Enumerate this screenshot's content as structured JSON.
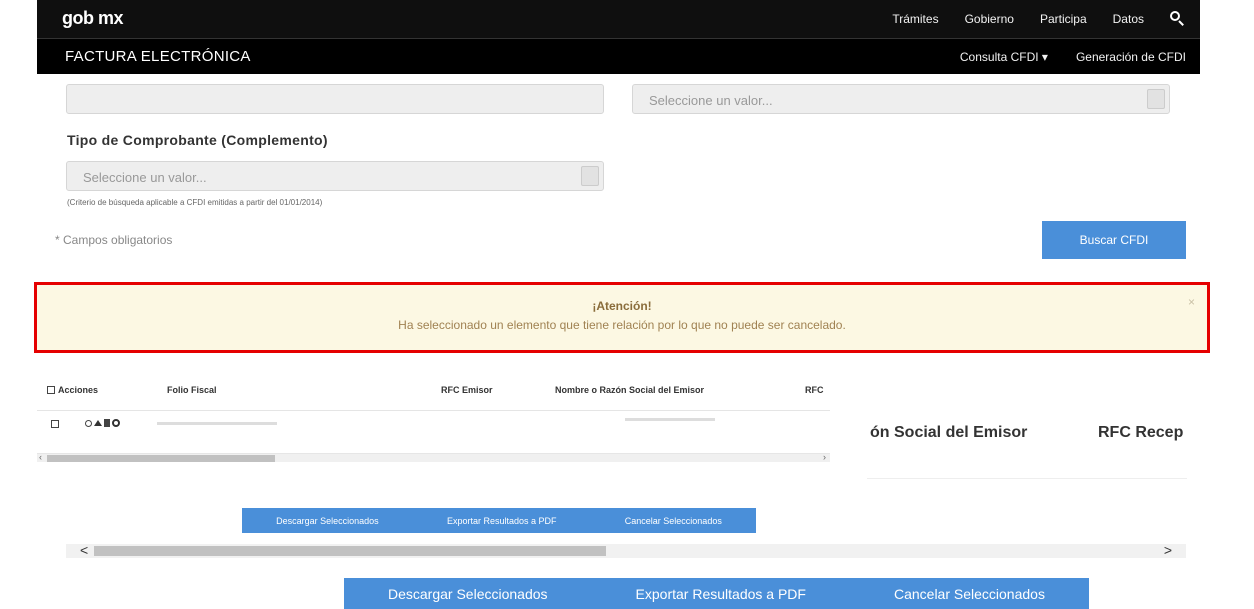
{
  "header": {
    "logo": "gob mx",
    "nav": [
      "Trámites",
      "Gobierno",
      "Participa",
      "Datos"
    ],
    "search_icon": "search-icon"
  },
  "subheader": {
    "title": "FACTURA ELECTRÓNICA",
    "nav": [
      "Consulta CFDI ▾",
      "Generación de CFDI"
    ]
  },
  "form": {
    "select_placeholder": "Seleccione un valor...",
    "tipo_label": "Tipo de Comprobante (Complemento)",
    "tipo_placeholder": "Seleccione un valor...",
    "hint": "(Criterio de búsqueda aplicable a CFDI emitidas a partir del 01/01/2014)",
    "required_note": "* Campos obligatorios",
    "search_button": "Buscar CFDI"
  },
  "alert": {
    "title": "¡Atención!",
    "message": "Ha seleccionado un elemento que tiene relación por lo que no puede ser cancelado.",
    "close": "×",
    "border_color": "#e50000"
  },
  "table": {
    "columns": [
      "Acciones",
      "Folio Fiscal",
      "RFC Emisor",
      "Nombre o Razón Social del Emisor",
      "RFC"
    ],
    "zoomed_columns": [
      "ón Social del Emisor",
      "RFC Recep"
    ],
    "row_icons": [
      "magnifier-icon",
      "arrows-icon",
      "document-icon",
      "ring-icon"
    ]
  },
  "actions_small": [
    "Descargar Seleccionados",
    "Exportar Resultados a PDF",
    "Cancelar Seleccionados"
  ],
  "actions_large": [
    "Descargar Seleccionados",
    "Exportar Resultados a PDF",
    "Cancelar Seleccionados"
  ],
  "scroll": {
    "left_arrow": "<",
    "right_arrow": ">",
    "small_left": "‹",
    "small_right": "›"
  },
  "colors": {
    "primary": "#4a8fd9",
    "alert_bg": "#fcf8e3",
    "header_bg": "#0f0f0f"
  }
}
